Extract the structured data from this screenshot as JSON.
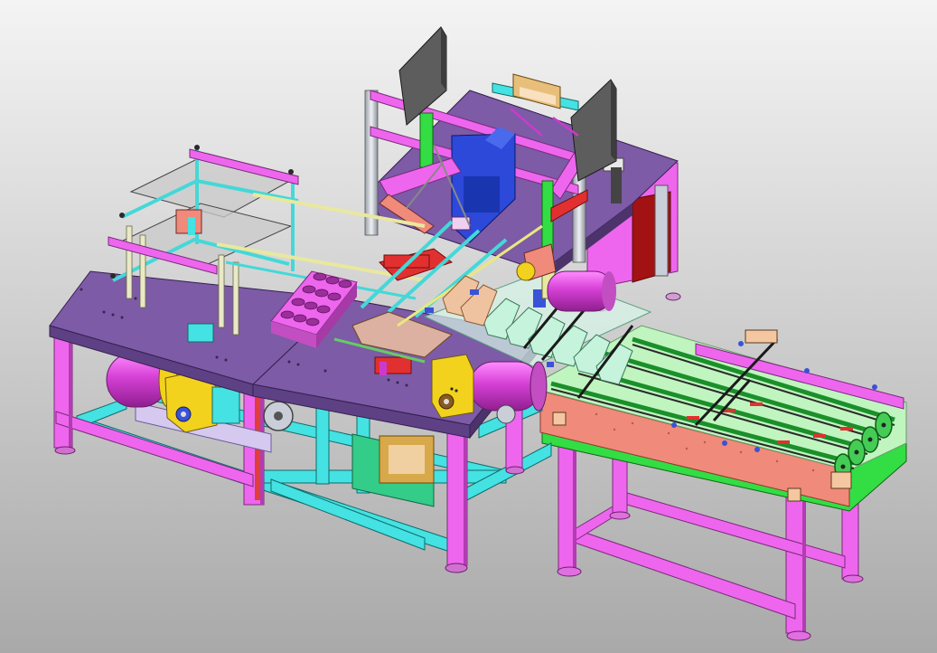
{
  "viewport": {
    "background_top": "#f4f4f4",
    "background_bottom": "#a9a9a9"
  },
  "colors": {
    "frame_magenta": "#ee66ee",
    "frame_magenta_dark": "#b23cb2",
    "frame_cyan": "#44e2e2",
    "frame_cyan_dark": "#1fa8a8",
    "deck_purple": "#7d5ba6",
    "deck_purple_dark": "#5e4184",
    "conveyor_salmon": "#f08a7a",
    "conveyor_green": "#33dd44",
    "motor_yellow": "#f2d21c",
    "guard_gray": "#5d5d5d",
    "panel_blue": "#2c49d9",
    "part_red": "#e23030",
    "slot_mint": "#c6f3dc",
    "steel": "#c9ced8",
    "tan": "#e8bf7a"
  },
  "machine_parts": [
    "base-frame-left",
    "base-frame-right",
    "worktable-left",
    "worktable-right",
    "upper-frame-platform",
    "guard-panel-left",
    "guard-panel-right",
    "carton-magazine-panel",
    "cross-frame-assembly",
    "cylinder-motor-left",
    "cylinder-motor-right",
    "gearbox",
    "cup-tray",
    "bucket-conveyor",
    "output-conveyor",
    "output-conveyor-legs",
    "side-cabinet"
  ]
}
